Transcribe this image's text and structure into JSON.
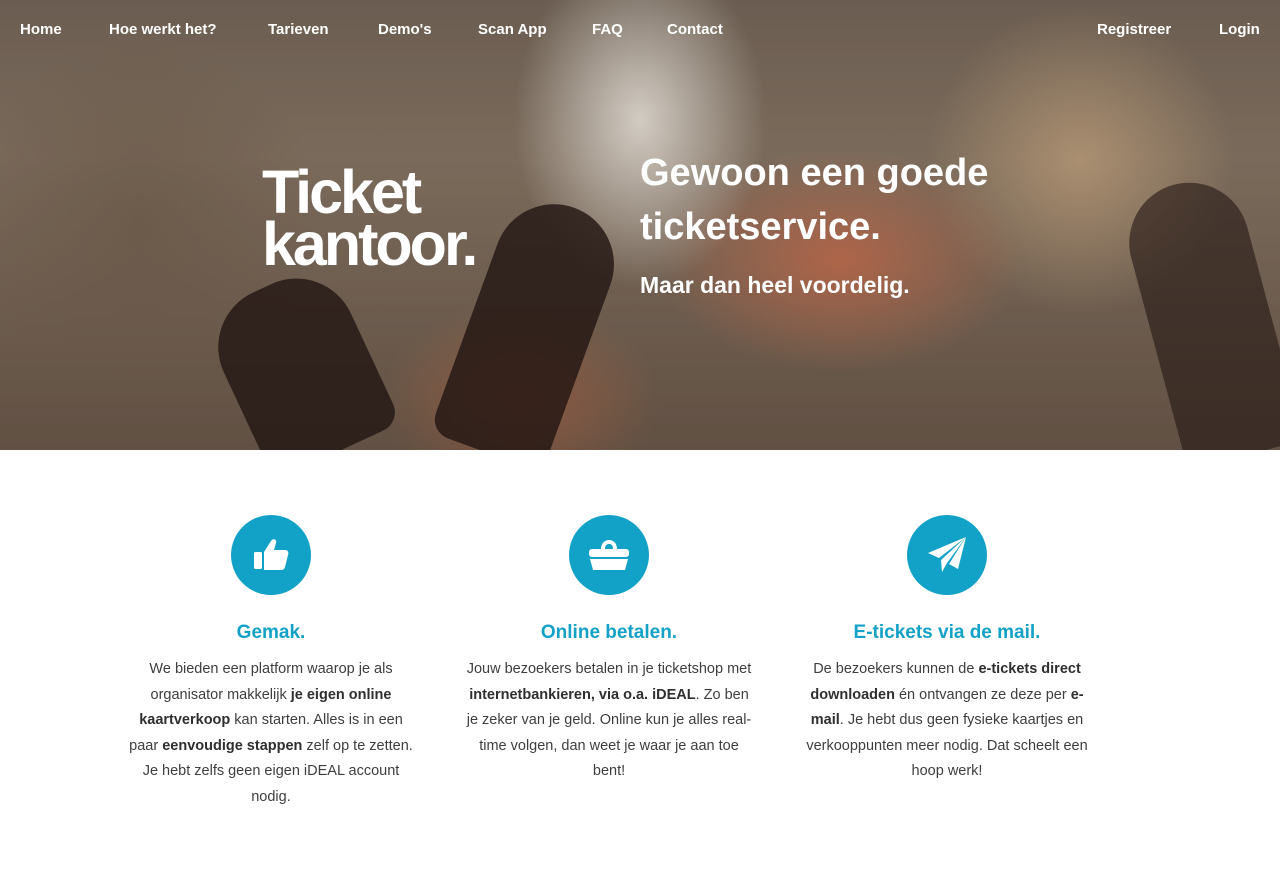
{
  "nav": {
    "left": [
      "Home",
      "Hoe werkt het?",
      "Tarieven",
      "Demo's",
      "Scan App",
      "FAQ",
      "Contact"
    ],
    "register": "Registreer",
    "login": "Login"
  },
  "hero": {
    "logo_line1": "Ticket",
    "logo_line2": "kantoor.",
    "headline": "Gewoon een goede ticketservice.",
    "subline": "Maar dan heel voordelig."
  },
  "features": [
    {
      "icon": "thumbs-up-icon",
      "title": "Gemak.",
      "parts": [
        {
          "t": "We bieden een platform waarop je als organisator makkelijk "
        },
        {
          "t": "je eigen online kaartverkoop",
          "b": true
        },
        {
          "t": " kan starten. Alles is in een paar "
        },
        {
          "t": "eenvoudige stappen",
          "b": true
        },
        {
          "t": " zelf op te zetten. Je hebt zelfs geen eigen iDEAL account nodig."
        }
      ]
    },
    {
      "icon": "wallet-icon",
      "title": "Online betalen.",
      "parts": [
        {
          "t": "Jouw bezoekers betalen in je ticketshop met "
        },
        {
          "t": "internetbankieren, via o.a. iDEAL",
          "b": true
        },
        {
          "t": ". Zo ben je zeker van je geld. Online kun je alles real-time volgen, dan weet je waar je aan toe bent!"
        }
      ]
    },
    {
      "icon": "paper-plane-icon",
      "title": "E-tickets via de mail.",
      "parts": [
        {
          "t": "De bezoekers kunnen de "
        },
        {
          "t": "e-tickets direct downloaden",
          "b": true
        },
        {
          "t": " én ontvangen ze deze per "
        },
        {
          "t": "e-mail",
          "b": true
        },
        {
          "t": ". Je hebt dus geen fysieke kaartjes en verkooppunten meer nodig. Dat scheelt een hoop werk!"
        }
      ]
    }
  ],
  "colors": {
    "accent": "#13a2c7",
    "text": "#3e3e3e"
  }
}
